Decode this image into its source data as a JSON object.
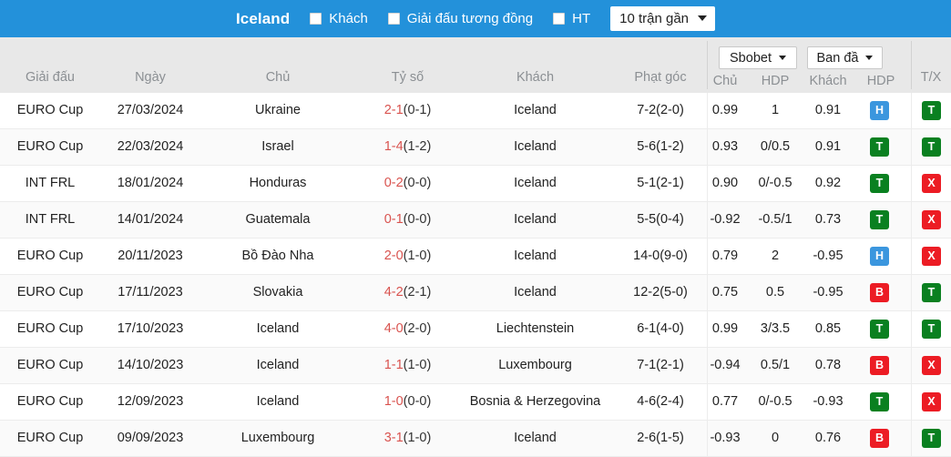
{
  "topbar": {
    "team": "Iceland",
    "filters": [
      {
        "label": "Khách",
        "checked": false
      },
      {
        "label": "Giải đấu tương đồng",
        "checked": false
      },
      {
        "label": "HT",
        "checked": false
      }
    ],
    "period_select": {
      "value": "10 trận gần",
      "icon": "chevron-down-icon"
    },
    "bg_color": "#2391da"
  },
  "table": {
    "headers": {
      "league": "Giải đấu",
      "date": "Ngày",
      "home": "Chủ",
      "score": "Tỷ số",
      "away": "Khách",
      "corner": "Phạt góc",
      "odds_home": "Chủ",
      "odds_hdp1": "HDP",
      "odds_away": "Khách",
      "odds_hdp2": "HDP",
      "tx": "T/X"
    },
    "bookmaker_select": {
      "value": "Sbobet",
      "icon": "chevron-down-icon"
    },
    "oddstype_select": {
      "value": "Ban đầ",
      "icon": "chevron-down-icon"
    },
    "rows": [
      {
        "league": "EURO Cup",
        "date": "27/03/2024",
        "home": "Ukraine",
        "home_link": false,
        "score_main": "2-1",
        "score_ht": "(0-1)",
        "away": "Iceland",
        "away_link": true,
        "corner": "7-2(2-0)",
        "odds_home": "0.99",
        "hdp1": "1",
        "odds_away": "0.91",
        "hdp_badge": "H",
        "tx_badge": "T"
      },
      {
        "league": "EURO Cup",
        "date": "22/03/2024",
        "home": "Israel",
        "home_link": false,
        "score_main": "1-4",
        "score_ht": "(1-2)",
        "away": "Iceland",
        "away_link": true,
        "corner": "5-6(1-2)",
        "odds_home": "0.93",
        "hdp1": "0/0.5",
        "odds_away": "0.91",
        "hdp_badge": "T",
        "tx_badge": "T"
      },
      {
        "league": "INT FRL",
        "date": "18/01/2024",
        "home": "Honduras",
        "home_link": false,
        "score_main": "0-2",
        "score_ht": "(0-0)",
        "away": "Iceland",
        "away_link": true,
        "corner": "5-1(2-1)",
        "odds_home": "0.90",
        "hdp1": "0/-0.5",
        "odds_away": "0.92",
        "hdp_badge": "T",
        "tx_badge": "X"
      },
      {
        "league": "INT FRL",
        "date": "14/01/2024",
        "home": "Guatemala",
        "home_link": false,
        "score_main": "0-1",
        "score_ht": "(0-0)",
        "away": "Iceland",
        "away_link": true,
        "corner": "5-5(0-4)",
        "odds_home": "-0.92",
        "hdp1": "-0.5/1",
        "odds_away": "0.73",
        "hdp_badge": "T",
        "tx_badge": "X"
      },
      {
        "league": "EURO Cup",
        "date": "20/11/2023",
        "home": "Bồ Đào Nha",
        "home_link": false,
        "score_main": "2-0",
        "score_ht": "(1-0)",
        "away": "Iceland",
        "away_link": true,
        "corner": "14-0(9-0)",
        "odds_home": "0.79",
        "hdp1": "2",
        "odds_away": "-0.95",
        "hdp_badge": "H",
        "tx_badge": "X"
      },
      {
        "league": "EURO Cup",
        "date": "17/11/2023",
        "home": "Slovakia",
        "home_link": false,
        "score_main": "4-2",
        "score_ht": "(2-1)",
        "away": "Iceland",
        "away_link": true,
        "corner": "12-2(5-0)",
        "odds_home": "0.75",
        "hdp1": "0.5",
        "odds_away": "-0.95",
        "hdp_badge": "B",
        "tx_badge": "T"
      },
      {
        "league": "EURO Cup",
        "date": "17/10/2023",
        "home": "Iceland",
        "home_link": true,
        "score_main": "4-0",
        "score_ht": "(2-0)",
        "away": "Liechtenstein",
        "away_link": false,
        "corner": "6-1(4-0)",
        "odds_home": "0.99",
        "hdp1": "3/3.5",
        "odds_away": "0.85",
        "hdp_badge": "T",
        "tx_badge": "T"
      },
      {
        "league": "EURO Cup",
        "date": "14/10/2023",
        "home": "Iceland",
        "home_link": true,
        "score_main": "1-1",
        "score_ht": "(1-0)",
        "away": "Luxembourg",
        "away_link": false,
        "corner": "7-1(2-1)",
        "odds_home": "-0.94",
        "hdp1": "0.5/1",
        "odds_away": "0.78",
        "hdp_badge": "B",
        "tx_badge": "X"
      },
      {
        "league": "EURO Cup",
        "date": "12/09/2023",
        "home": "Iceland",
        "home_link": true,
        "score_main": "1-0",
        "score_ht": "(0-0)",
        "away": "Bosnia & Herzegovina",
        "away_link": false,
        "corner": "4-6(2-4)",
        "odds_home": "0.77",
        "hdp1": "0/-0.5",
        "odds_away": "-0.93",
        "hdp_badge": "T",
        "tx_badge": "X"
      },
      {
        "league": "EURO Cup",
        "date": "09/09/2023",
        "home": "Luxembourg",
        "home_link": false,
        "score_main": "3-1",
        "score_ht": "(1-0)",
        "away": "Iceland",
        "away_link": true,
        "corner": "2-6(1-5)",
        "odds_home": "-0.93",
        "hdp1": "0",
        "odds_away": "0.76",
        "hdp_badge": "B",
        "tx_badge": "T"
      }
    ]
  },
  "colors": {
    "header_blue": "#2391da",
    "subheader_gray": "#e8e8e8",
    "score_red": "#d9534f",
    "link_blue": "#5b9bd5",
    "badge_win": "#0a8020",
    "badge_lose": "#ec1c24",
    "badge_half": "#3b96de"
  }
}
